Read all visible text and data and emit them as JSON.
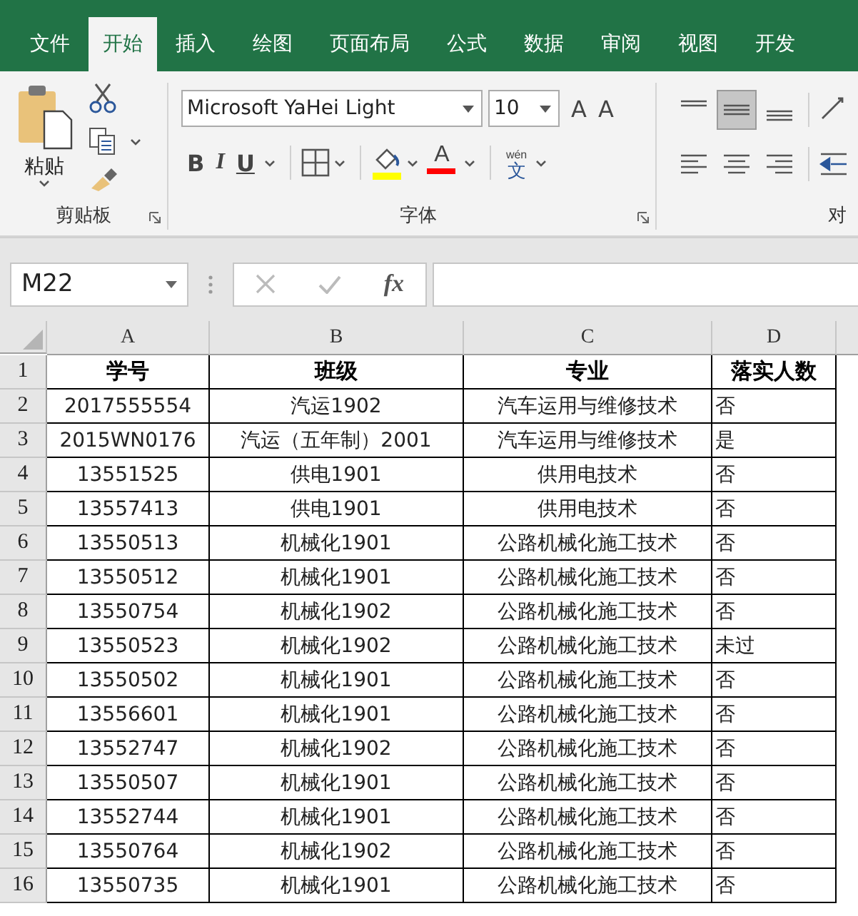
{
  "tabs": [
    {
      "label": "文件",
      "selected": false
    },
    {
      "label": "开始",
      "selected": true
    },
    {
      "label": "插入",
      "selected": false
    },
    {
      "label": "绘图",
      "selected": false
    },
    {
      "label": "页面布局",
      "selected": false
    },
    {
      "label": "公式",
      "selected": false
    },
    {
      "label": "数据",
      "selected": false
    },
    {
      "label": "审阅",
      "selected": false
    },
    {
      "label": "视图",
      "selected": false
    },
    {
      "label": "开发",
      "selected": false
    }
  ],
  "ribbon": {
    "clipboard": {
      "paste_label": "粘贴",
      "group_label": "剪贴板"
    },
    "font": {
      "font_name": "Microsoft YaHei Light",
      "font_size": "10",
      "grow_label": "A",
      "shrink_label": "A",
      "bold_label": "B",
      "italic_label": "I",
      "underline_label": "U",
      "font_color_label": "A",
      "phonetic_pinyin": "wén",
      "phonetic_char": "文",
      "group_label": "字体"
    },
    "alignment": {
      "top_buttons": [
        {
          "kind": "top",
          "selected": false
        },
        {
          "kind": "middle",
          "selected": true
        },
        {
          "kind": "bottom",
          "selected": false
        },
        {
          "kind": "orientation",
          "selected": false
        }
      ],
      "bottom_buttons": [
        {
          "kind": "left",
          "selected": false
        },
        {
          "kind": "center",
          "selected": false
        },
        {
          "kind": "right",
          "selected": false
        },
        {
          "kind": "indent",
          "selected": false
        }
      ],
      "group_label": "对"
    }
  },
  "formula_bar": {
    "name_box": "M22",
    "function_label": "fx"
  },
  "sheet": {
    "columns": [
      "A",
      "B",
      "C",
      "D"
    ],
    "rows": [
      {
        "number": "1",
        "kind": "header",
        "cells": [
          "学号",
          "班级",
          "专业",
          "落实人数"
        ]
      },
      {
        "number": "2",
        "kind": "data",
        "cells": [
          "2017555554",
          "汽运1902",
          "汽车运用与维修技术",
          "否"
        ]
      },
      {
        "number": "3",
        "kind": "data",
        "cells": [
          "2015WN0176",
          "汽运（五年制）2001",
          "汽车运用与维修技术",
          "是"
        ]
      },
      {
        "number": "4",
        "kind": "data",
        "cells": [
          "13551525",
          "供电1901",
          "供用电技术",
          "否"
        ]
      },
      {
        "number": "5",
        "kind": "data",
        "cells": [
          "13557413",
          "供电1901",
          "供用电技术",
          "否"
        ]
      },
      {
        "number": "6",
        "kind": "data",
        "cells": [
          "13550513",
          "机械化1901",
          "公路机械化施工技术",
          "否"
        ]
      },
      {
        "number": "7",
        "kind": "data",
        "cells": [
          "13550512",
          "机械化1901",
          "公路机械化施工技术",
          "否"
        ]
      },
      {
        "number": "8",
        "kind": "data",
        "cells": [
          "13550754",
          "机械化1902",
          "公路机械化施工技术",
          "否"
        ]
      },
      {
        "number": "9",
        "kind": "data",
        "cells": [
          "13550523",
          "机械化1902",
          "公路机械化施工技术",
          "未过"
        ]
      },
      {
        "number": "10",
        "kind": "data",
        "cells": [
          "13550502",
          "机械化1901",
          "公路机械化施工技术",
          "否"
        ]
      },
      {
        "number": "11",
        "kind": "data",
        "cells": [
          "13556601",
          "机械化1901",
          "公路机械化施工技术",
          "否"
        ]
      },
      {
        "number": "12",
        "kind": "data",
        "cells": [
          "13552747",
          "机械化1902",
          "公路机械化施工技术",
          "否"
        ]
      },
      {
        "number": "13",
        "kind": "data",
        "cells": [
          "13550507",
          "机械化1901",
          "公路机械化施工技术",
          "否"
        ]
      },
      {
        "number": "14",
        "kind": "data",
        "cells": [
          "13552744",
          "机械化1901",
          "公路机械化施工技术",
          "否"
        ]
      },
      {
        "number": "15",
        "kind": "data",
        "cells": [
          "13550764",
          "机械化1902",
          "公路机械化施工技术",
          "否"
        ]
      },
      {
        "number": "16",
        "kind": "data",
        "cells": [
          "13550735",
          "机械化1901",
          "公路机械化施工技术",
          "否"
        ]
      }
    ]
  }
}
